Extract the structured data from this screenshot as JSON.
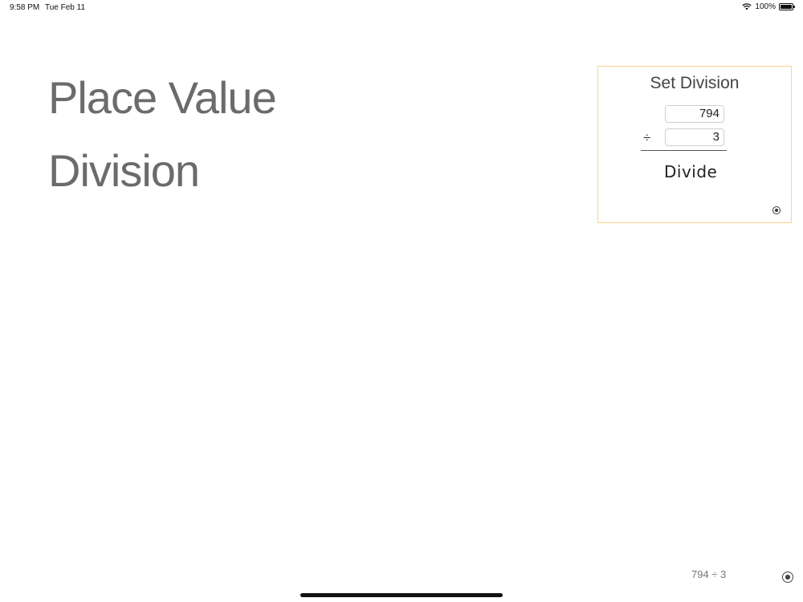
{
  "status_bar": {
    "time": "9:58 PM",
    "date": "Tue Feb 11",
    "battery": "100%",
    "icons": [
      "wifi-icon",
      "battery-icon"
    ]
  },
  "heading": {
    "line1": "Place Value",
    "line2": "Division"
  },
  "panel": {
    "title": "Set Division",
    "dividend": "794",
    "divisor": "3",
    "operator": "÷",
    "divide_label": "Divide",
    "accent_border": "#f7d58a"
  },
  "footer": {
    "expression": "794 ÷ 3"
  }
}
